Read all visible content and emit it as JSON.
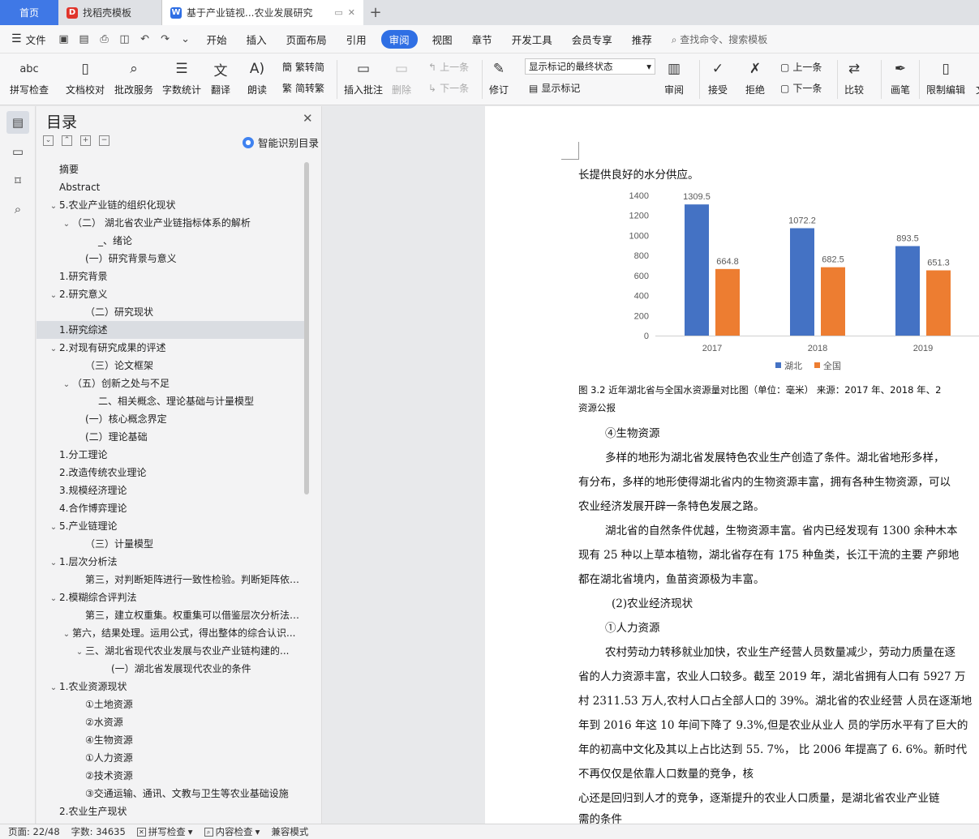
{
  "tabs": [
    {
      "label": "首页"
    },
    {
      "label": "找稻壳模板"
    },
    {
      "label": "基于产业链视...农业发展研究"
    }
  ],
  "menu": {
    "file": "文件",
    "items": [
      "开始",
      "插入",
      "页面布局",
      "引用",
      "审阅",
      "视图",
      "章节",
      "开发工具",
      "会员专享",
      "推荐"
    ],
    "active": "审阅",
    "search": "查找命令、搜索模板"
  },
  "ribbon": {
    "spell": "拼写检查",
    "proof": "文档校对",
    "batch": "批改服务",
    "wordcount": "字数统计",
    "translate": "翻译",
    "read": "朗读",
    "trad": "繁转简",
    "simp": "简转繁",
    "insert_comment": "插入批注",
    "delete": "删除",
    "prev": "上一条",
    "next": "下一条",
    "track": "修订",
    "markup_state": "显示标记的最终状态",
    "show_markup": "显示标记",
    "review": "审阅",
    "accept": "接受",
    "reject": "拒绝",
    "prev2": "上一条",
    "next2": "下一条",
    "compare": "比较",
    "pen": "画笔",
    "restrict": "限制编辑",
    "doc": "文"
  },
  "toc": {
    "title": "目录",
    "smart": "智能识别目录",
    "items": [
      {
        "label": "摘要",
        "indent": 0,
        "caret": ""
      },
      {
        "label": "Abstract",
        "indent": 0,
        "caret": ""
      },
      {
        "label": "5.农业产业链的组织化现状",
        "indent": 0,
        "caret": "v"
      },
      {
        "label": "（二） 湖北省农业产业链指标体系的解析",
        "indent": 1,
        "caret": "v"
      },
      {
        "label": "_、绪论",
        "indent": 3,
        "caret": ""
      },
      {
        "label": "(一）研究背景与意义",
        "indent": 2,
        "caret": ""
      },
      {
        "label": "1.研究背景",
        "indent": 0,
        "caret": ""
      },
      {
        "label": "2.研究意义",
        "indent": 0,
        "caret": "v"
      },
      {
        "label": "（二）研究现状",
        "indent": 2,
        "caret": ""
      },
      {
        "label": "1.研究综述",
        "indent": 0,
        "caret": "",
        "selected": true
      },
      {
        "label": "2.对现有研究成果的评述",
        "indent": 0,
        "caret": "v"
      },
      {
        "label": "（三）论文框架",
        "indent": 2,
        "caret": ""
      },
      {
        "label": "（五）创新之处与不足",
        "indent": 1,
        "caret": "v"
      },
      {
        "label": "二、相关概念、理论基础与计量模型",
        "indent": 3,
        "caret": ""
      },
      {
        "label": "(一）核心概念界定",
        "indent": 2,
        "caret": ""
      },
      {
        "label": "(二）理论基础",
        "indent": 2,
        "caret": ""
      },
      {
        "label": "1.分工理论",
        "indent": 0,
        "caret": ""
      },
      {
        "label": "2.改造传统农业理论",
        "indent": 0,
        "caret": ""
      },
      {
        "label": "3.规模经济理论",
        "indent": 0,
        "caret": ""
      },
      {
        "label": "4.合作博弈理论",
        "indent": 0,
        "caret": ""
      },
      {
        "label": "5.产业链理论",
        "indent": 0,
        "caret": "v"
      },
      {
        "label": "（三）计量模型",
        "indent": 2,
        "caret": ""
      },
      {
        "label": "1.层次分析法",
        "indent": 0,
        "caret": "v"
      },
      {
        "label": "第三，对判断矩阵进行一致性检验。判断矩阵依据层次...",
        "indent": 2,
        "caret": ""
      },
      {
        "label": "2.模糊综合评判法",
        "indent": 0,
        "caret": "v"
      },
      {
        "label": "第三，建立权重集。权重集可以借鉴层次分析法的结果...",
        "indent": 2,
        "caret": ""
      },
      {
        "label": "第六，结果处理。运用公式，得出整体的综合认识...",
        "indent": 1,
        "caret": "v"
      },
      {
        "label": "三、湖北省现代农业发展与农业产业链构建的...",
        "indent": 2,
        "caret": "v"
      },
      {
        "label": "(一）湖北省发展现代农业的条件",
        "indent": 4,
        "caret": ""
      },
      {
        "label": "1.农业资源现状",
        "indent": 0,
        "caret": "v"
      },
      {
        "label": "①土地资源",
        "indent": 2,
        "caret": ""
      },
      {
        "label": "②水资源",
        "indent": 2,
        "caret": ""
      },
      {
        "label": "④生物资源",
        "indent": 2,
        "caret": ""
      },
      {
        "label": "①人力资源",
        "indent": 2,
        "caret": ""
      },
      {
        "label": "②技术资源",
        "indent": 2,
        "caret": ""
      },
      {
        "label": "③交通运输、通讯、文教与卫生等农业基础设施",
        "indent": 2,
        "caret": ""
      },
      {
        "label": "2.农业生产现状",
        "indent": 0,
        "caret": ""
      }
    ]
  },
  "doc": {
    "line0": "长提供良好的水分供应。",
    "caption1": "图 3.2 近年湖北省与全国水资源量对比图（单位：毫米） 来源：2017 年、2018 年、2",
    "caption2": "资源公报",
    "p1": "④生物资源",
    "p2": "多样的地形为湖北省发展特色农业生产创造了条件。湖北省地形多样，",
    "p3": "有分布，多样的地形使得湖北省内的生物资源丰富，拥有各种生物资源，可以",
    "p4": "农业经济发展开辟一条特色发展之路。",
    "p5": "湖北省的自然条件优越，生物资源丰富。省内已经发现有 1300 余种木本",
    "p6": "现有 25 种以上草本植物，湖北省存在有 175 种鱼类，长江干流的主要 产卵地",
    "p7": "都在湖北省境内，鱼苗资源极为丰富。",
    "p8": "(2)农业经济现状",
    "p9": "①人力资源",
    "p10": "农村劳动力转移就业加快，农业生产经营人员数量减少，劳动力质量在逐",
    "p11": "省的人力资源丰富，农业人口较多。截至 2019 年，湖北省拥有人口有 5927 万",
    "p12": "村 2311.53 万人,农村人口占全部人口的 39%。湖北省的农业经营 人员在逐渐地",
    "p13": "年到 2016 年这 10 年间下降了 9.3%,但是农业从业人 员的学历水平有了巨大的",
    "p14": "年的初高中文化及其以上占比达到 55. 7%， 比 2006 年提高了 6. 6%。新时代",
    "p15": "不再仅仅是依靠人口数量的竞争，核",
    "p16": "心还是回归到人才的竞争，逐渐提升的农业人口质量，是湖北省农业产业链",
    "p17": "需的条件"
  },
  "chart_data": {
    "type": "bar",
    "categories": [
      "2017",
      "2018",
      "2019"
    ],
    "series": [
      {
        "name": "湖北",
        "color": "#4472c4",
        "values": [
          1309.5,
          1072.2,
          893.5
        ]
      },
      {
        "name": "全国",
        "color": "#ed7d31",
        "values": [
          664.8,
          682.5,
          651.3
        ]
      }
    ],
    "yticks": [
      "0",
      "200",
      "400",
      "600",
      "800",
      "1000",
      "1200",
      "1400"
    ],
    "ylim": [
      0,
      1400
    ],
    "grid": false,
    "legend": "bottom"
  },
  "status": {
    "page": "页面: 22/48",
    "words": "字数: 34635",
    "spell": "拼写检查",
    "content": "内容检查",
    "compat": "兼容模式"
  }
}
